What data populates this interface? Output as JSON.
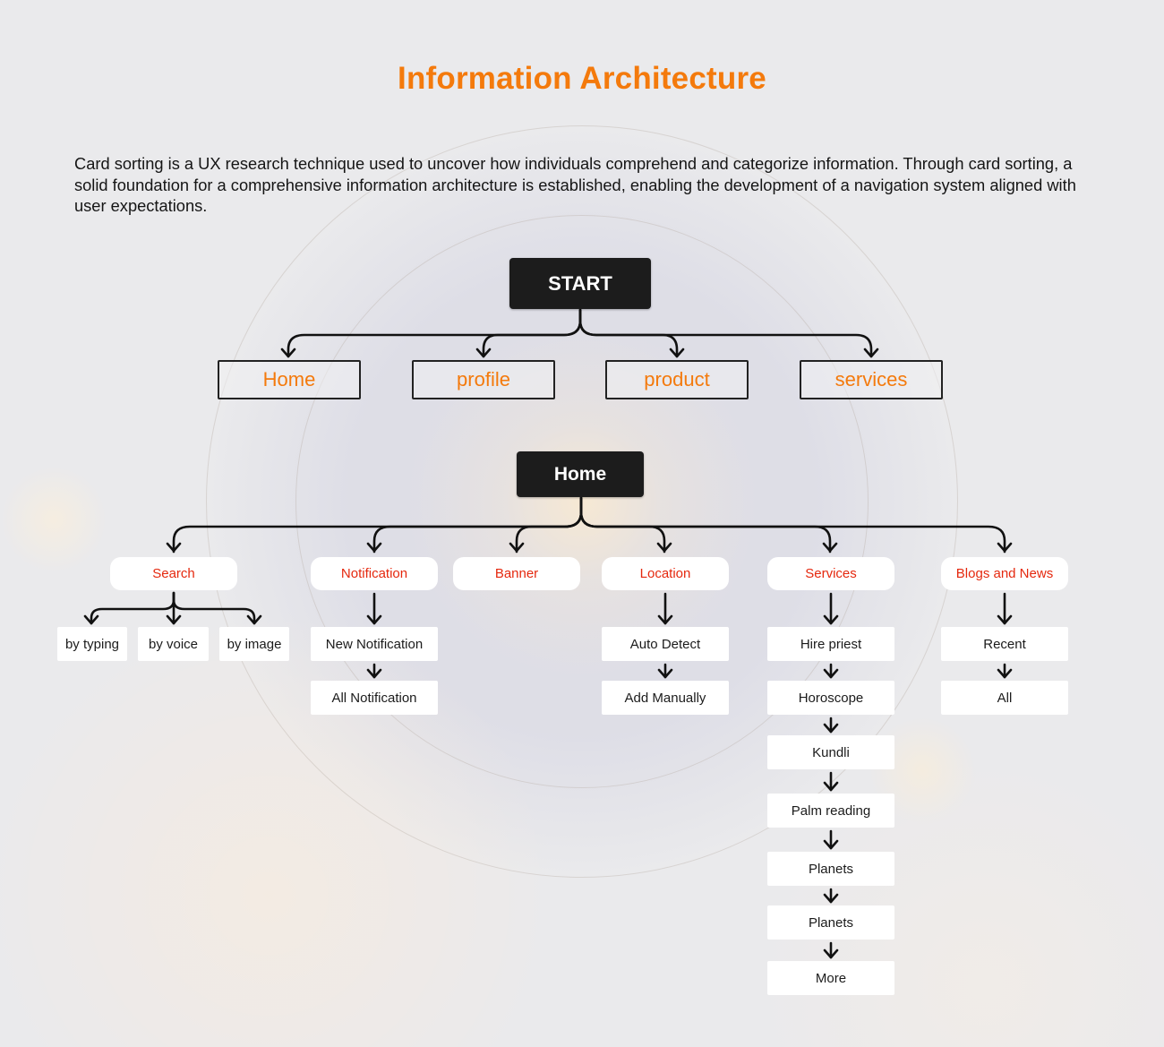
{
  "header": {
    "title": "Information Architecture",
    "description": "Card sorting is a UX research technique used to uncover how individuals comprehend and categorize information. Through card sorting, a solid foundation for a comprehensive information architecture is established, enabling the development of a navigation system aligned with user expectations."
  },
  "colors": {
    "title": "#f47a0c",
    "top_level_text": "#f47a0c",
    "category_text": "#e5280e",
    "dark_node_bg": "#1c1c1c"
  },
  "sitemap": {
    "root": "START",
    "top_level": [
      "Home",
      "profile",
      "product",
      "services"
    ]
  },
  "home_tree": {
    "root": "Home",
    "categories": [
      {
        "label": "Search",
        "children": [
          "by typing",
          "by voice",
          "by image"
        ],
        "layout": "branch"
      },
      {
        "label": "Notification",
        "children": [
          "New Notification",
          "All Notification"
        ],
        "layout": "sequence"
      },
      {
        "label": "Banner",
        "children": [],
        "layout": "none"
      },
      {
        "label": "Location",
        "children": [
          "Auto Detect",
          "Add Manually"
        ],
        "layout": "sequence"
      },
      {
        "label": "Services",
        "children": [
          "Hire priest",
          "Horoscope",
          "Kundli",
          "Palm reading",
          "Planets",
          "Planets",
          "More"
        ],
        "layout": "sequence"
      },
      {
        "label": "Blogs and News",
        "children": [
          "Recent",
          "All"
        ],
        "layout": "sequence"
      }
    ]
  }
}
